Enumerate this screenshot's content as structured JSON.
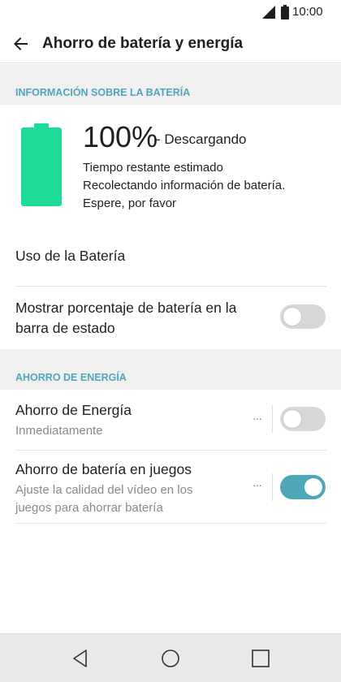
{
  "status_bar": {
    "time": "10:00",
    "icons": [
      "signal-icon",
      "battery-icon"
    ]
  },
  "app_bar": {
    "title": "Ahorro de batería y energía",
    "back_icon": "back-arrow-icon"
  },
  "battery_section": {
    "header": "INFORMACIÓN SOBRE LA BATERÍA",
    "percent": "100%",
    "state": "- Descargando",
    "lines": [
      "Tiempo restante estimado",
      "Recolectando información de batería.",
      "Espere, por favor"
    ],
    "level": 1.0,
    "battery_color": "#1ddc98"
  },
  "items": {
    "battery_usage": {
      "title": "Uso de la Batería"
    },
    "show_percentage": {
      "title_line1": "Mostrar porcentaje de batería en la",
      "title_line2": "barra de estado",
      "enabled": false
    }
  },
  "energy_section": {
    "header": "AHORRO DE ENERGÍA",
    "power_saving": {
      "title": "Ahorro de Energía",
      "subtitle": "Inmediatamente",
      "more": "···",
      "enabled": false
    },
    "game_battery_saving": {
      "title": "Ahorro de batería en juegos",
      "subtitle_line1": "Ajuste la calidad del vídeo en los",
      "subtitle_line2": "juegos para ahorrar batería",
      "more": "···",
      "enabled": true
    }
  },
  "nav_bar": {
    "buttons": [
      "back-triangle-icon",
      "home-circle-icon",
      "recents-square-icon"
    ]
  },
  "colors": {
    "accent": "#4fa6b8",
    "section_bg": "#f0f0f0",
    "toggle_off": "#d7d7d7"
  }
}
